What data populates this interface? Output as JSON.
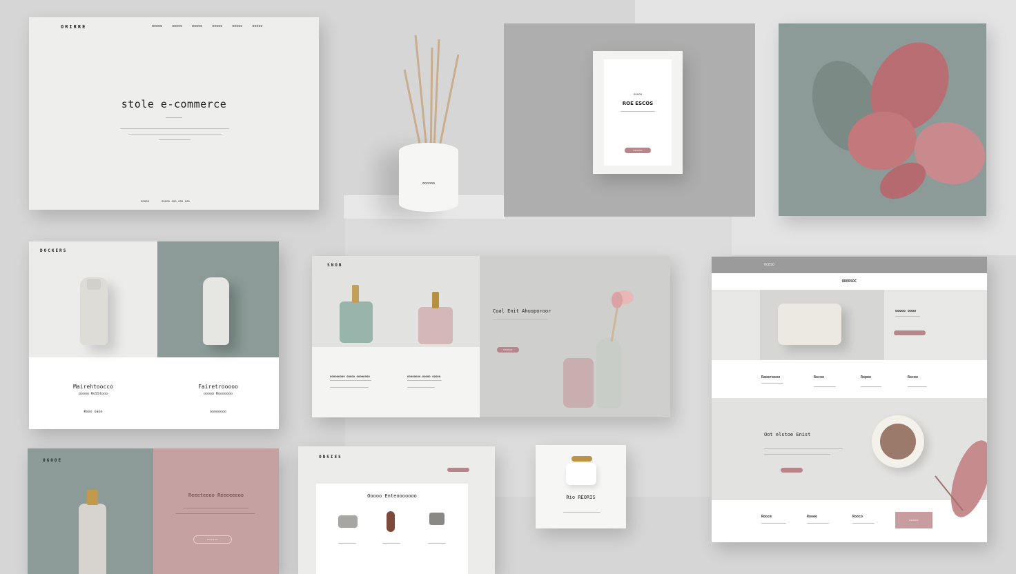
{
  "hero": {
    "brand": "ORIRRE",
    "nav": [
      "ooooo",
      "ooooo",
      "ooooo",
      "ooooo",
      "ooooo",
      "ooooo"
    ],
    "title": "stole e-commerce",
    "footer_left": "ooooo",
    "footer_right": "ooooo ooo ooo ooo"
  },
  "diffuser": {
    "label": "oooooo"
  },
  "card": {
    "kicker": "ooooo",
    "title": "ROE ESCOS",
    "button": "ooooo"
  },
  "products": {
    "brand": "DOCKERS",
    "left_title": "Mairehtoocco",
    "left_sub": "ooooo RoSStooo",
    "left_link": "Rooo oaoo",
    "right_title": "Fairetrooooo",
    "right_sub": "ooooo Rooooooo",
    "right_link": "oooooooo"
  },
  "soaps": {
    "brand": "SNOB",
    "headline": "Coal Enit Ahuoporoor",
    "cta": "ooooo",
    "item1_title": "ooooooooo ooooo oooooooo",
    "item2_title": "oooooooo ooooo ooooo"
  },
  "right_site": {
    "brand": "OCESO",
    "subtitle": "RRERSOC",
    "product_info": "ooooo oooo",
    "cols": [
      "Raoeroooo",
      "Rocoo",
      "Ropeo",
      "Roceo"
    ],
    "section_title": "Oot elstoe Enist",
    "footer_cols": [
      "Rooce",
      "Rooeo",
      "Rooco"
    ],
    "footer_button": "ooooo"
  },
  "bottle_panel": {
    "brand": "OGOOE",
    "title": "Reeeteeoo Reeeeeeoo",
    "button": "oooooo"
  },
  "shop": {
    "brand": "ONSIES",
    "inner_title": "Ooooo Enteooooooo"
  },
  "jar_card": {
    "title": "Rio REORIS"
  },
  "colors": {
    "background": "#d6d6d6",
    "sage": "#8c9b97",
    "rose": "#b7868a",
    "paper": "#eeeeec"
  }
}
